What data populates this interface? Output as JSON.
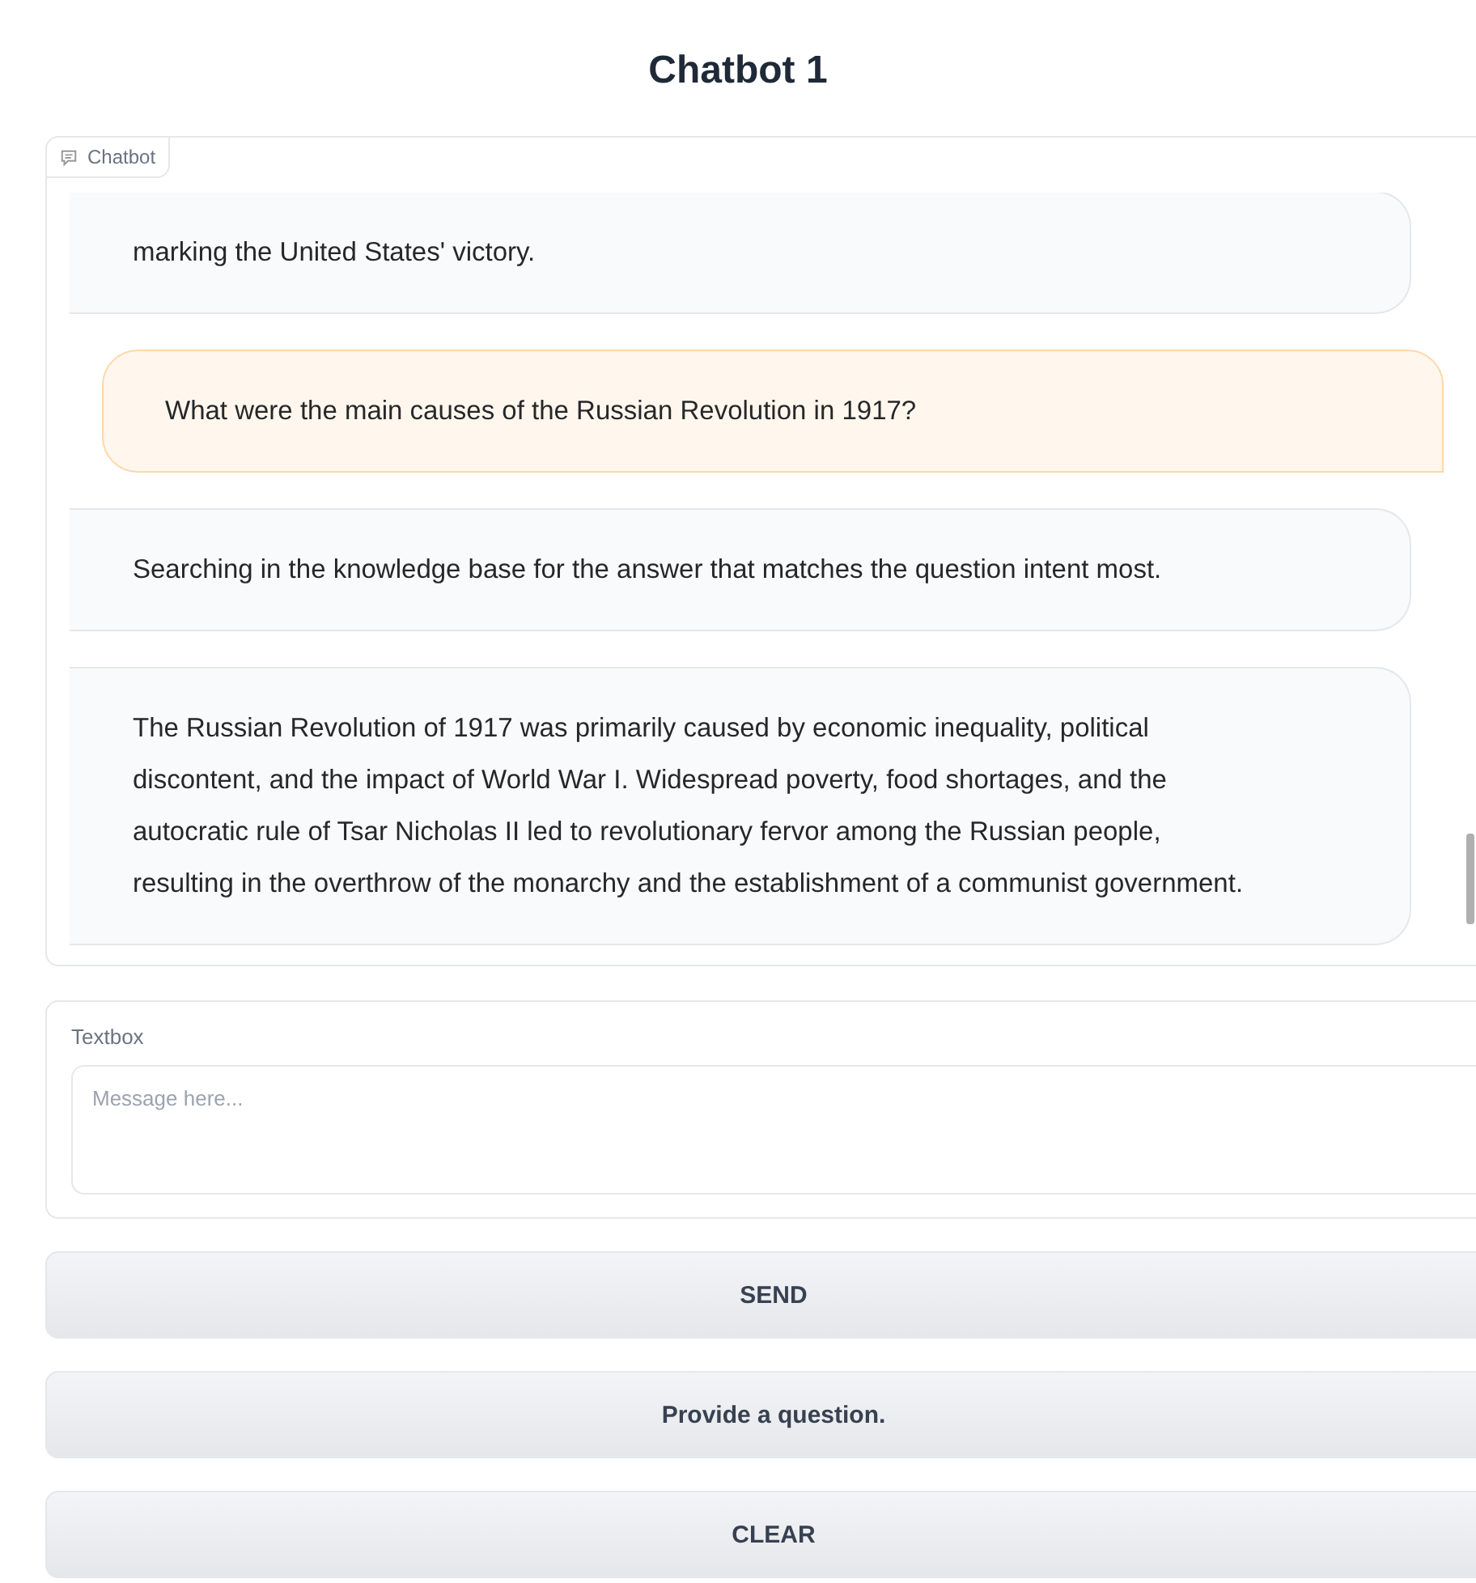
{
  "title": "Chatbot 1",
  "chatbot": {
    "label": "Chatbot",
    "messages": [
      {
        "kind": "bot",
        "text": "marking the United States' victory."
      },
      {
        "kind": "user",
        "text": "What were the main causes of the Russian Revolution in 1917?"
      },
      {
        "kind": "bot",
        "text": "Searching in the knowledge base for the answer that matches the question intent most."
      },
      {
        "kind": "bot",
        "text": "The Russian Revolution of 1917 was primarily caused by economic inequality, political discontent, and the impact of World War I. Widespread poverty, food shortages, and the autocratic rule of Tsar Nicholas II led to revolutionary fervor among the Russian people, resulting in the overthrow of the monarchy and the establishment of a communist government."
      }
    ]
  },
  "textbox": {
    "label": "Textbox",
    "placeholder": "Message here..."
  },
  "buttons": [
    "SEND",
    "Provide a question.",
    "CLEAR"
  ]
}
